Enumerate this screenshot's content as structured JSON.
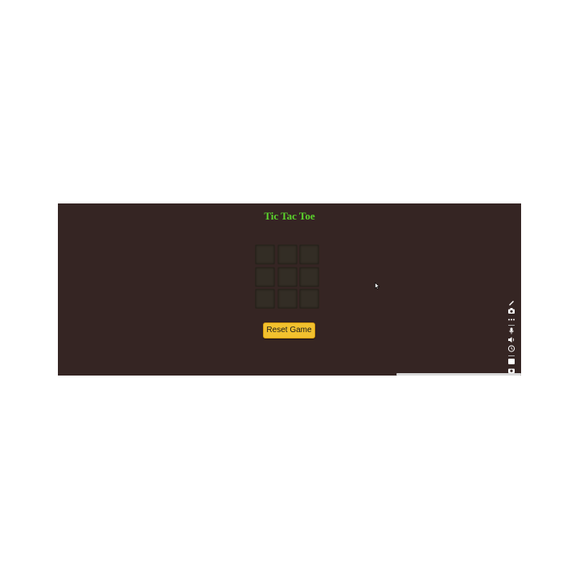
{
  "game": {
    "title": "Tic Tac Toe",
    "cells": [
      "",
      "",
      "",
      "",
      "",
      "",
      "",
      "",
      ""
    ],
    "reset_label": "Reset Game"
  },
  "toolbar": {
    "icons": [
      "pen-icon",
      "camera-icon",
      "more-icon",
      "divider",
      "microphone-icon",
      "speaker-icon",
      "timer-icon",
      "window-icon",
      "settings-icon"
    ]
  },
  "colors": {
    "background": "#352523",
    "title": "#5bd52c",
    "cell": "#332d25",
    "button": "#f2c12e"
  }
}
